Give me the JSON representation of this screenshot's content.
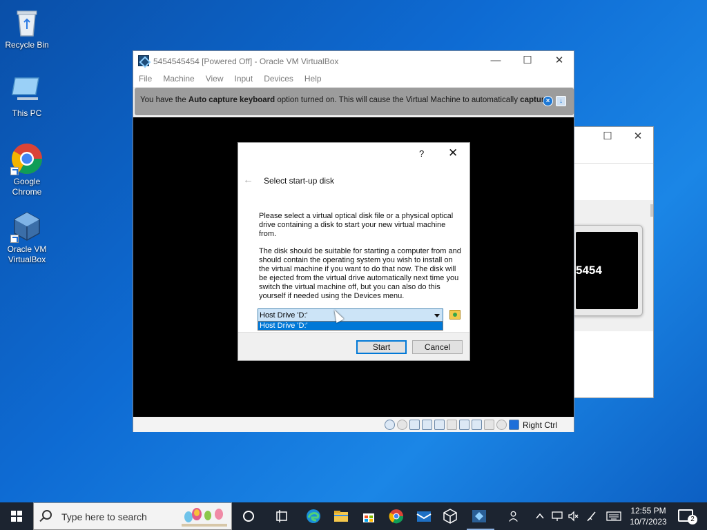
{
  "desktop": {
    "icons": [
      {
        "label": "Recycle Bin"
      },
      {
        "label": "This PC"
      },
      {
        "label": "Google Chrome"
      },
      {
        "label": "Oracle VM VirtualBox"
      }
    ]
  },
  "background_window": {
    "preview_text": "5454"
  },
  "vbox_window": {
    "title": "5454545454 [Powered Off] - Oracle VM VirtualBox",
    "menu": [
      "File",
      "Machine",
      "View",
      "Input",
      "Devices",
      "Help"
    ],
    "banner": {
      "prefix": "You have the ",
      "bold1": "Auto capture keyboard",
      "middle": " option turned on. This will cause the Virtual Machine to automatically ",
      "bold2": "capture"
    },
    "status_host_key": "Right Ctrl"
  },
  "dialog": {
    "help": "?",
    "close": "✕",
    "heading": "Select start-up disk",
    "para1": "Please select a virtual optical disk file or a physical optical drive containing a disk to start your new virtual machine from.",
    "para2": "The disk should be suitable for starting a computer from and should contain the operating system you wish to install on the virtual machine if you want to do that now. The disk will be ejected from the virtual drive automatically next time you switch the virtual machine off, but you can also do this yourself if needed using the Devices menu.",
    "combo_value": "Host Drive 'D:'",
    "dropdown_options": [
      "Host Drive 'D:'"
    ],
    "start_label": "Start",
    "cancel_label": "Cancel"
  },
  "taskbar": {
    "search_placeholder": "Type here to search",
    "time": "12:55 PM",
    "date": "10/7/2023",
    "notification_count": "2"
  },
  "colors": {
    "desktop": "#0e6bd3",
    "taskbar": "#1c2430",
    "accent": "#0078d7"
  }
}
